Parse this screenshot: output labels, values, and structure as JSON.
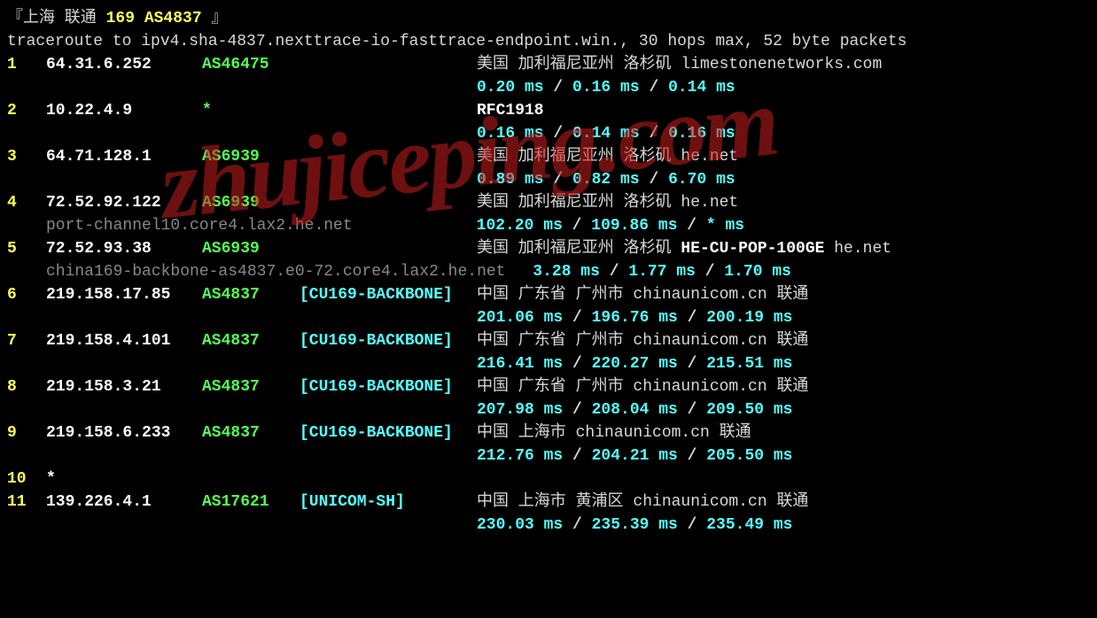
{
  "header": {
    "open": "『",
    "title": "上海 联通",
    "nums": "169 AS4837",
    "close": " 』"
  },
  "traceroute_line": "traceroute to ipv4.sha-4837.nexttrace-io-fasttrace-endpoint.win., 30 hops max, 52 byte packets",
  "watermark": "zhujiceping.com",
  "hops": [
    {
      "n": "1",
      "ip": "64.31.6.252",
      "asn": "AS46475",
      "label": "",
      "loc": "美国 加利福尼亚州 洛杉矶",
      "tag": "",
      "link": "  limestonenetworks.com",
      "hostname": "",
      "t1": "0.20 ms",
      "t2": "0.16 ms",
      "t3": "0.14 ms"
    },
    {
      "n": "2",
      "ip": "10.22.4.9",
      "asn": "*",
      "label": "",
      "loc_rfc": "RFC1918",
      "hostname": "",
      "t1": "0.16 ms",
      "t2": "0.14 ms",
      "t3": "0.16 ms"
    },
    {
      "n": "3",
      "ip": "64.71.128.1",
      "asn": "AS6939",
      "label": "",
      "loc": "美国 加利福尼亚州 洛杉矶",
      "tag": "",
      "link": "  he.net",
      "hostname": "",
      "t1": "0.89 ms",
      "t2": "0.82 ms",
      "t3": "6.70 ms"
    },
    {
      "n": "4",
      "ip": "72.52.92.122",
      "asn": "AS6939",
      "label": "",
      "loc": "美国 加利福尼亚州 洛杉矶",
      "tag": "",
      "link": "  he.net",
      "hostname": "port-channel10.core4.lax2.he.net",
      "t1": "102.20 ms",
      "t2": "109.86 ms",
      "t3": "* ms"
    },
    {
      "n": "5",
      "ip": "72.52.93.38",
      "asn": "AS6939",
      "label": "",
      "loc": "美国 加利福尼亚州 洛杉矶 ",
      "tag": "HE-CU-POP-100GE",
      "link": " he.net",
      "hostname": "china169-backbone-as4837.e0-72.core4.lax2.he.net",
      "t1": "3.28 ms",
      "t2": "1.77 ms",
      "t3": "1.70 ms",
      "inline_timing": true
    },
    {
      "n": "6",
      "ip": "219.158.17.85",
      "asn": "AS4837",
      "label": "[CU169-BACKBONE]",
      "loc": "中国 广东省 广州市",
      "tag": "",
      "link": "  chinaunicom.cn  联通",
      "hostname": "",
      "t1": "201.06 ms",
      "t2": "196.76 ms",
      "t3": "200.19 ms"
    },
    {
      "n": "7",
      "ip": "219.158.4.101",
      "asn": "AS4837",
      "label": "[CU169-BACKBONE]",
      "loc": "中国 广东省 广州市",
      "tag": "",
      "link": "  chinaunicom.cn  联通",
      "hostname": "",
      "t1": "216.41 ms",
      "t2": "220.27 ms",
      "t3": "215.51 ms"
    },
    {
      "n": "8",
      "ip": "219.158.3.21",
      "asn": "AS4837",
      "label": "[CU169-BACKBONE]",
      "loc": "中国 广东省 广州市",
      "tag": "",
      "link": "  chinaunicom.cn  联通",
      "hostname": "",
      "t1": "207.98 ms",
      "t2": "208.04 ms",
      "t3": "209.50 ms"
    },
    {
      "n": "9",
      "ip": "219.158.6.233",
      "asn": "AS4837",
      "label": "[CU169-BACKBONE]",
      "loc": "中国 上海市  ",
      "tag": "",
      "link": " chinaunicom.cn  联通",
      "hostname": "",
      "t1": "212.76 ms",
      "t2": "204.21 ms",
      "t3": "205.50 ms"
    },
    {
      "n": "10",
      "ip": "*",
      "asn": "",
      "label": "",
      "loc": "",
      "tag": "",
      "link": "",
      "hostname": "",
      "no_timing": true
    },
    {
      "n": "11",
      "ip": "139.226.4.1",
      "asn": "AS17621",
      "label": "[UNICOM-SH]",
      "loc": "中国 上海市  黄浦区",
      "tag": "",
      "link": " chinaunicom.cn  联通",
      "hostname": "",
      "t1": "230.03 ms",
      "t2": "235.39 ms",
      "t3": "235.49 ms"
    }
  ]
}
